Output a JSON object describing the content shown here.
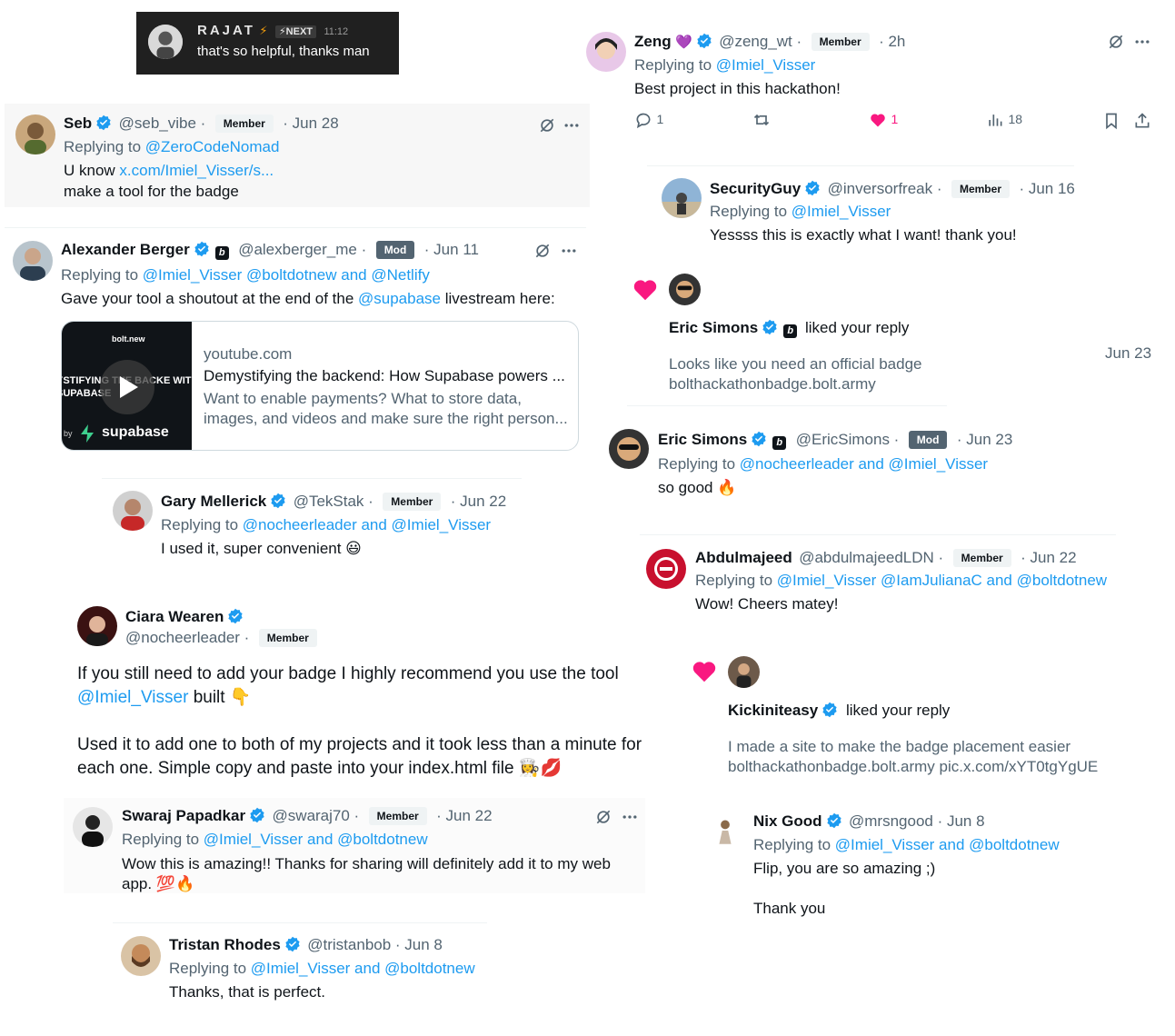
{
  "toast": {
    "name": "RAJAT",
    "bolt": "⚡",
    "next_badge": "⚡NEXT",
    "time": "11:12",
    "message": "that's so helpful, thanks man"
  },
  "seb": {
    "name": "Seb",
    "handle": "@seb_vibe ·",
    "badge": "Member",
    "date": "· Jun 28",
    "replying_prefix": "Replying to",
    "replying_to": "@ZeroCodeNomad",
    "text_prefix": "U know",
    "text_link": "x.com/Imiel_Visser/s...",
    "text_line2": "make a tool for the badge"
  },
  "alexander": {
    "name": "Alexander Berger",
    "handle": "@alexberger_me ·",
    "badge": "Mod",
    "date": "· Jun 11",
    "replying_prefix": "Replying to",
    "replying_to": "@Imiel_Visser @boltdotnew and @Netlify",
    "text_prefix": "Gave your tool a shoutout at the end of the",
    "text_link": "@supabase",
    "text_suffix": "livestream here:",
    "card": {
      "domain": "youtube.com",
      "title": "Demystifying the backend: How Supabase powers ...",
      "desc": "Want to enable payments? What to store data, images, and videos and make sure the right person...",
      "thumb_brand": "bolt.new",
      "thumb_text": "YSTIFYING THE BACKE WITH SUPABASE",
      "thumb_logo": "supabase",
      "thumb_by": "by"
    }
  },
  "gary": {
    "name": "Gary Mellerick",
    "handle": "@TekStak ·",
    "badge": "Member",
    "date": "· Jun 22",
    "replying_prefix": "Replying to",
    "replying_to": "@nocheerleader and @Imiel_Visser",
    "text": "I used it, super convenient 😃"
  },
  "ciara": {
    "name": "Ciara Wearen",
    "handle": "@nocheerleader ·",
    "badge": "Member",
    "p1_prefix": "If you still need to add your badge I highly recommend you use the tool",
    "p1_link": "@Imiel_Visser",
    "p1_suffix": "built 👇",
    "p2": "Used it to add one to both of my projects and it took less than a minute for each one. Simple copy and paste into your index.html file 👩‍🍳💋"
  },
  "swaraj": {
    "name": "Swaraj Papadkar",
    "handle": "@swaraj70 ·",
    "badge": "Member",
    "date": "· Jun 22",
    "replying_prefix": "Replying to",
    "replying_to": "@Imiel_Visser and @boltdotnew",
    "text": "Wow this is amazing!! Thanks for sharing will definitely add it to my web app. 💯🔥"
  },
  "tristan": {
    "name": "Tristan Rhodes",
    "handle": "@tristanbob · Jun 8",
    "replying_prefix": "Replying to",
    "replying_to": "@Imiel_Visser and @boltdotnew",
    "text": "Thanks, that is perfect."
  },
  "zeng": {
    "name": "Zeng",
    "heart": "💜",
    "handle": "@zeng_wt ·",
    "badge": "Member",
    "date": "· 2h",
    "replying_prefix": "Replying to",
    "replying_to": "@Imiel_Visser",
    "text": "Best project in this hackathon!",
    "replies": "1",
    "likes": "1",
    "views": "18"
  },
  "security": {
    "name": "SecurityGuy",
    "handle": "@inversorfreak ·",
    "badge": "Member",
    "date": "· Jun 16",
    "replying_prefix": "Replying to",
    "replying_to": "@Imiel_Visser",
    "text": "Yessss this is exactly what I want! thank you!"
  },
  "liked1": {
    "name": "Eric Simons",
    "action": "liked your reply",
    "date": "Jun 23",
    "line1": "Looks like you need an official badge",
    "line2": "bolthackathonbadge.bolt.army"
  },
  "eric": {
    "name": "Eric Simons",
    "handle": "@EricSimons ·",
    "badge": "Mod",
    "date": "· Jun 23",
    "replying_prefix": "Replying to",
    "replying_to": "@nocheerleader and @Imiel_Visser",
    "text": "so good 🔥"
  },
  "abdul": {
    "name": "Abdulmajeed",
    "handle": "@abdulmajeedLDN ·",
    "badge": "Member",
    "date": "· Jun 22",
    "replying_prefix": "Replying to",
    "replying_to": "@Imiel_Visser @IamJulianaC and @boltdotnew",
    "text": "Wow! Cheers matey!"
  },
  "liked2": {
    "name": "Kickiniteasy",
    "action": "liked your reply",
    "line1": "I made a site to make the badge placement easier",
    "line2": "bolthackathonbadge.bolt.army pic.x.com/xYT0tgYgUE"
  },
  "nix": {
    "name": "Nix Good",
    "handle": "@mrsngood · Jun 8",
    "replying_prefix": "Replying to",
    "replying_to": "@Imiel_Visser and @boltdotnew",
    "line1": "Flip, you are so amazing ;)",
    "line2": "Thank you"
  },
  "colors": {
    "link": "#1d9bf0",
    "muted": "#536471",
    "heart": "#f91880",
    "verified": "#1d9bf0"
  }
}
